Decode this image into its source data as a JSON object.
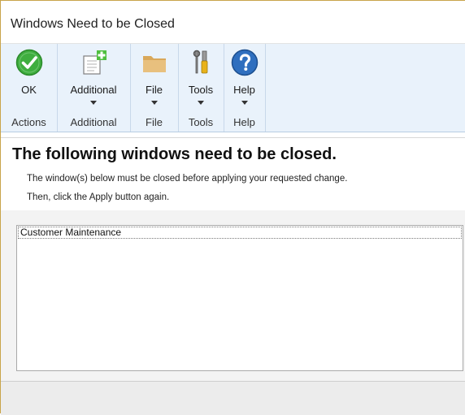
{
  "window": {
    "title": "Windows Need to be Closed"
  },
  "ribbon": {
    "groups": [
      {
        "button_label": "OK",
        "caption": "Actions",
        "icon": "ok-check-icon",
        "has_dropdown": false
      },
      {
        "button_label": "Additional",
        "caption": "Additional",
        "icon": "additional-add-icon",
        "has_dropdown": true
      },
      {
        "button_label": "File",
        "caption": "File",
        "icon": "folder-icon",
        "has_dropdown": true
      },
      {
        "button_label": "Tools",
        "caption": "Tools",
        "icon": "tools-icon",
        "has_dropdown": true
      },
      {
        "button_label": "Help",
        "caption": "Help",
        "icon": "help-icon",
        "has_dropdown": true
      }
    ]
  },
  "message": {
    "heading": "The following windows need to be closed.",
    "line1": "The window(s) below must be closed before applying your requested change.",
    "line2": "Then, click the Apply button again."
  },
  "list": {
    "items": [
      "Customer Maintenance"
    ]
  },
  "colors": {
    "ribbon_bg": "#e9f2fb",
    "ok_green": "#3fae3f",
    "help_blue": "#2f6fbf",
    "folder_tan": "#e2b872",
    "window_border": "#c9a44a"
  }
}
